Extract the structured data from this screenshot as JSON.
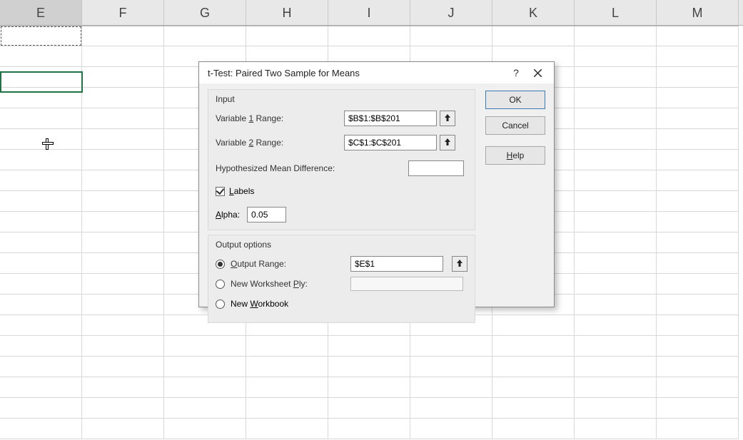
{
  "columns": [
    "E",
    "F",
    "G",
    "H",
    "I",
    "J",
    "K",
    "L",
    "M"
  ],
  "selectedColumn": "E",
  "dialog": {
    "title": "t-Test: Paired Two Sample for Means",
    "help_glyph": "?",
    "input_section": "Input",
    "var1_label_pre": "Variable ",
    "var1_label_u": "1",
    "var1_label_post": " Range:",
    "var1_value": "$B$1:$B$201",
    "var2_label_pre": "Variable ",
    "var2_label_u": "2",
    "var2_label_post": " Range:",
    "var2_value": "$C$1:$C$201",
    "hypo_label": "Hypothesized Mean Difference:",
    "hypo_value": "",
    "labels_checkbox_u": "L",
    "labels_checkbox_post": "abels",
    "labels_checked": true,
    "alpha_label_u": "A",
    "alpha_label_post": "lpha:",
    "alpha_value": "0.05",
    "output_section": "Output options",
    "output_range_u": "O",
    "output_range_post": "utput Range:",
    "output_range_value": "$E$1",
    "new_ws_pre": "New Worksheet ",
    "new_ws_u": "P",
    "new_ws_post": "ly:",
    "new_wb_pre": "New ",
    "new_wb_u": "W",
    "new_wb_post": "orkbook",
    "output_choice": "range"
  },
  "buttons": {
    "ok": "OK",
    "cancel": "Cancel",
    "help_u": "H",
    "help_post": "elp"
  }
}
